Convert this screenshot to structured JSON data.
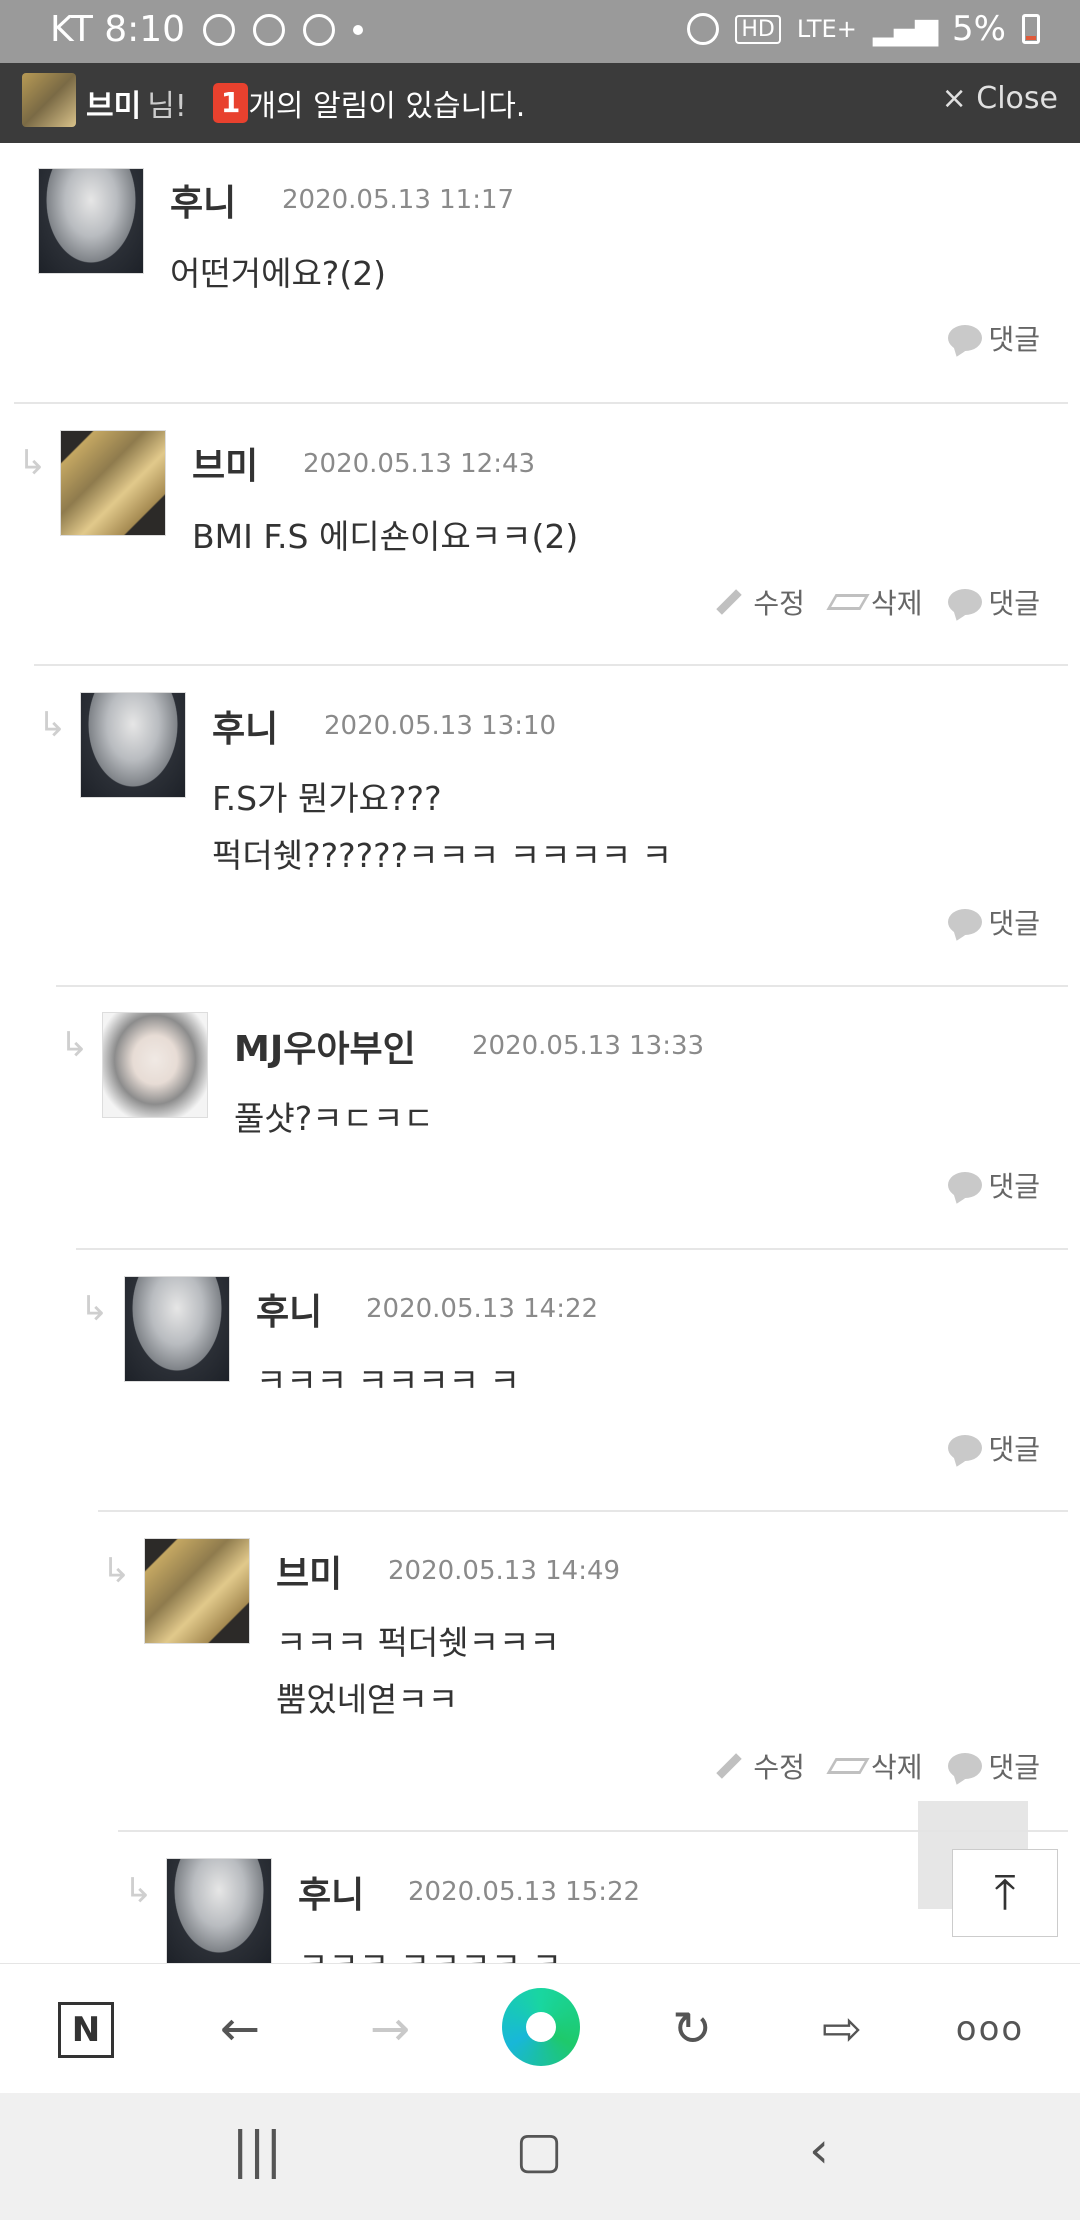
{
  "status_bar": {
    "carrier_time": "KT 8:10",
    "network": "LTE+",
    "battery": "5%"
  },
  "notification": {
    "user": "브미",
    "suffix": "님!",
    "count": "1",
    "message": "개의 알림이 있습니다.",
    "close": "× Close"
  },
  "labels": {
    "edit": "수정",
    "delete": "삭제",
    "reply": "댓글"
  },
  "comments": [
    {
      "name": "후니",
      "date": "2020.05.13 11:17",
      "body": "어떤거에요?(2)"
    },
    {
      "name": "브미",
      "date": "2020.05.13 12:43",
      "body": "BMI F.S 에디숀이요ㅋㅋ(2)"
    },
    {
      "name": "후니",
      "date": "2020.05.13 13:10",
      "body": "F.S가 뭔가요???\n퍽더쉣??????ㅋㅋㅋ ㅋㅋㅋㅋ ㅋ"
    },
    {
      "name": "MJ우아부인",
      "date": "2020.05.13 13:33",
      "body": "풀샷?ㅋㄷㅋㄷ"
    },
    {
      "name": "후니",
      "date": "2020.05.13 14:22",
      "body": "ㅋㅋㅋ ㅋㅋㅋㅋ ㅋ"
    },
    {
      "name": "브미",
      "date": "2020.05.13 14:49",
      "body": "ㅋㅋㅋ 퍽더쉣ㅋㅋㅋ\n뿜었네엳ㅋㅋ"
    },
    {
      "name": "후니",
      "date": "2020.05.13 15:22",
      "body": "ㅋㅋㅋ ㅋㅋㅋㅋ ㅋ"
    }
  ],
  "toolbar": {
    "n_label": "N"
  }
}
